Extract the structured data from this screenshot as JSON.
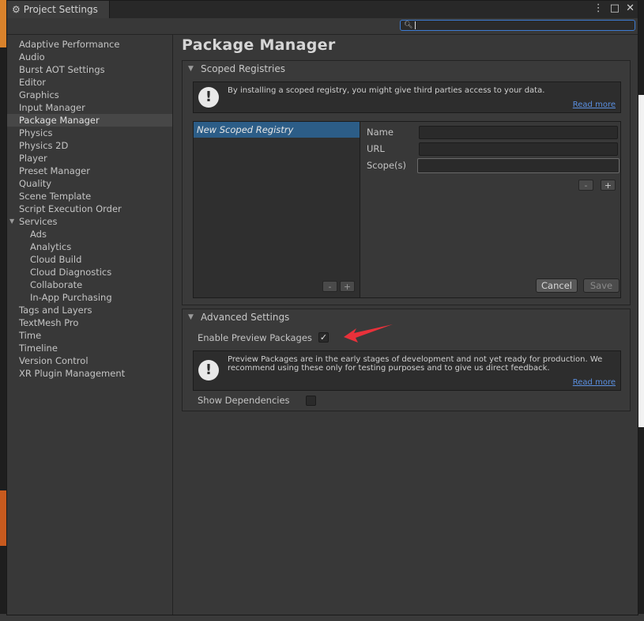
{
  "window": {
    "tab_title": "Project Settings",
    "menu_icon": "kebab-menu-icon",
    "maximize_icon": "maximize-icon",
    "close_icon": "close-icon"
  },
  "search": {
    "value": "",
    "placeholder": ""
  },
  "sidebar": {
    "items": [
      {
        "label": "Adaptive Performance"
      },
      {
        "label": "Audio"
      },
      {
        "label": "Burst AOT Settings"
      },
      {
        "label": "Editor"
      },
      {
        "label": "Graphics"
      },
      {
        "label": "Input Manager"
      },
      {
        "label": "Package Manager",
        "selected": true
      },
      {
        "label": "Physics"
      },
      {
        "label": "Physics 2D"
      },
      {
        "label": "Player"
      },
      {
        "label": "Preset Manager"
      },
      {
        "label": "Quality"
      },
      {
        "label": "Scene Template"
      },
      {
        "label": "Script Execution Order"
      },
      {
        "label": "Services",
        "expanded": true
      },
      {
        "label": "Ads"
      },
      {
        "label": "Analytics"
      },
      {
        "label": "Cloud Build"
      },
      {
        "label": "Cloud Diagnostics"
      },
      {
        "label": "Collaborate"
      },
      {
        "label": "In-App Purchasing"
      },
      {
        "label": "Tags and Layers"
      },
      {
        "label": "TextMesh Pro"
      },
      {
        "label": "Time"
      },
      {
        "label": "Timeline"
      },
      {
        "label": "Version Control"
      },
      {
        "label": "XR Plugin Management"
      }
    ]
  },
  "page": {
    "title": "Package Manager"
  },
  "scoped_registries": {
    "header": "Scoped Registries",
    "help_text": "By installing a scoped registry, you might give third parties access to your data.",
    "read_more": "Read more",
    "registry_items": [
      "New Scoped Registry"
    ],
    "list_remove": "-",
    "list_add": "+",
    "fields": {
      "name_label": "Name",
      "url_label": "URL",
      "scopes_label": "Scope(s)"
    },
    "scope_remove": "-",
    "scope_add": "+",
    "cancel": "Cancel",
    "save": "Save"
  },
  "advanced": {
    "header": "Advanced Settings",
    "enable_preview_label": "Enable Preview Packages",
    "enable_preview_checked": true,
    "checkmark": "✓",
    "help_text": "Preview Packages are in the early stages of development and not yet ready for production. We recommend using these only for testing purposes and to give us direct feedback.",
    "read_more": "Read more",
    "show_dependencies_label": "Show Dependencies",
    "show_dependencies_checked": false
  },
  "colors": {
    "selection": "#2c5d87",
    "link": "#5a8fe0",
    "annotation_arrow": "#e8313a"
  }
}
